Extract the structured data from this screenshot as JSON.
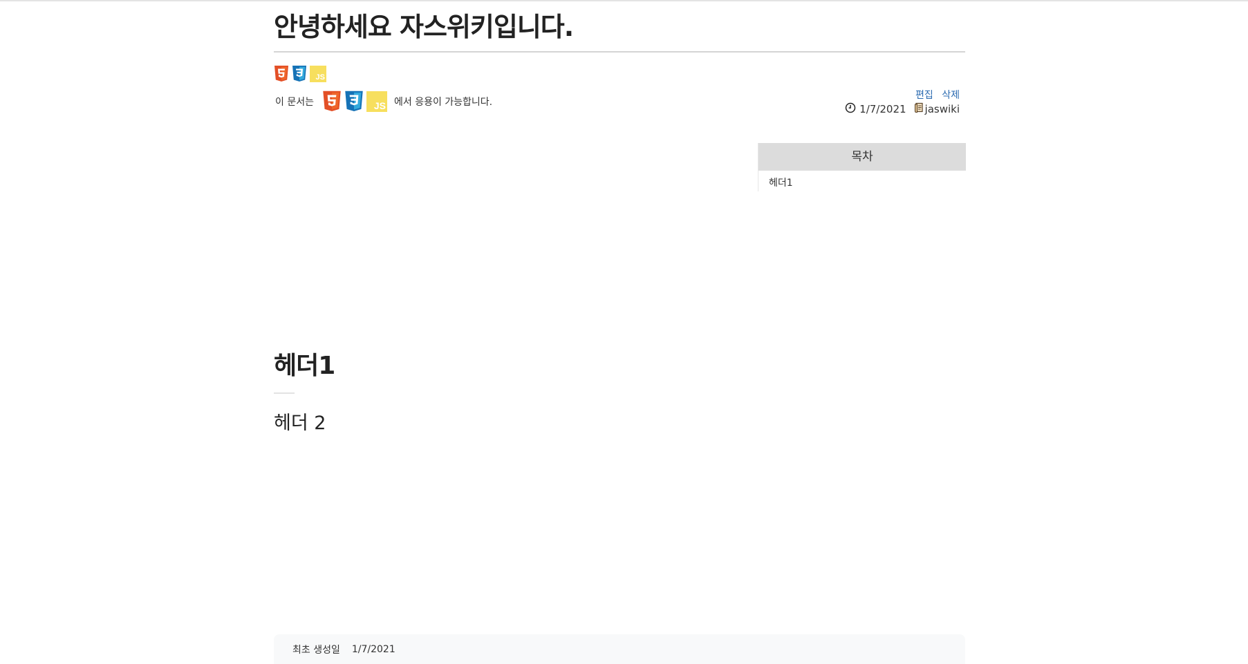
{
  "page": {
    "title": "안녕하세요 자스위키입니다."
  },
  "tech_badges": [
    "html5-icon",
    "css3-icon",
    "js-icon"
  ],
  "js_badge_text": "JS",
  "compat": {
    "prefix": "이 문서는",
    "suffix": "에서 응용이 가능합니다."
  },
  "actions": {
    "edit": "편집",
    "delete": "삭제"
  },
  "meta": {
    "date": "1/7/2021",
    "author": "jaswiki"
  },
  "toc": {
    "title": "목차",
    "items": [
      "헤더1"
    ]
  },
  "content": {
    "h1": "헤더1",
    "h2": "헤더 2"
  },
  "footer": {
    "created_label": "최초 생성일",
    "created_date": "1/7/2021"
  },
  "colors": {
    "html5": "#e34f26",
    "css3": "#1572b6",
    "js": "#f7df5e",
    "link": "#2a6ab0",
    "toc_header_bg": "#dcdcdc"
  }
}
